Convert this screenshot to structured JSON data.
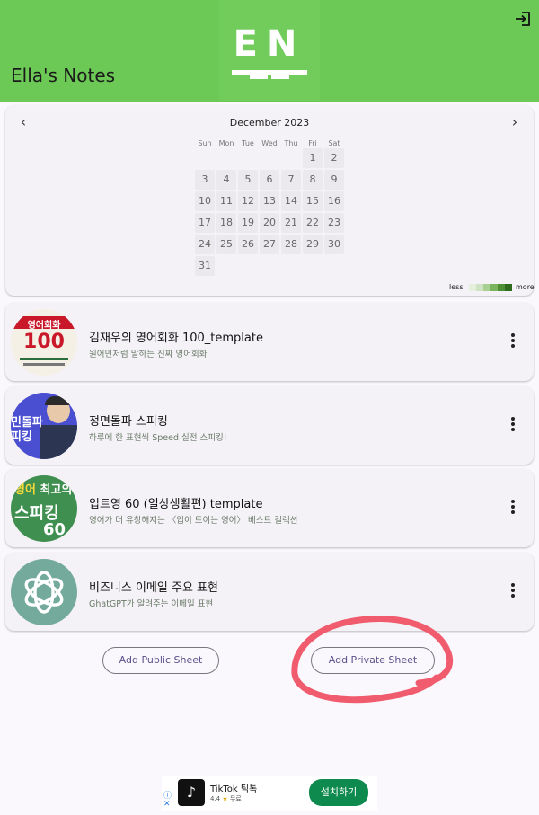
{
  "header": {
    "title": "Ella's Notes",
    "logo_text": "EN",
    "brand_color": "#6cc956",
    "login_icon": "login-icon"
  },
  "calendar": {
    "month_label": "December 2023",
    "prev_icon": "chevron-left-icon",
    "next_icon": "chevron-right-icon",
    "weekdays": [
      "Sun",
      "Mon",
      "Tue",
      "Wed",
      "Thu",
      "Fri",
      "Sat"
    ],
    "first_weekday_index": 5,
    "days": [
      "1",
      "2",
      "3",
      "4",
      "5",
      "6",
      "7",
      "8",
      "9",
      "10",
      "11",
      "12",
      "13",
      "14",
      "15",
      "16",
      "17",
      "18",
      "19",
      "20",
      "21",
      "22",
      "23",
      "24",
      "25",
      "26",
      "27",
      "28",
      "29",
      "30",
      "31"
    ],
    "legend_less": "less",
    "legend_more": "more",
    "legend_colors": [
      "#e4efdd",
      "#cfe3c4",
      "#a8cf94",
      "#7bb35f",
      "#4f8f34",
      "#2e6b1c"
    ]
  },
  "sheets": [
    {
      "title": "김재우의 영어회화 100_template",
      "subtitle": "원어민처럼 말하는 진짜 영어회화",
      "thumb_text": "영어회화 100",
      "more_icon": "more-vert-icon"
    },
    {
      "title": "정면돌파 스피킹",
      "subtitle": "하루에 한 표현씩 Speed 실전 스피킹!",
      "thumb_text": "민돌파 피킹",
      "more_icon": "more-vert-icon"
    },
    {
      "title": "입트영 60 (일상생활편) template",
      "subtitle": "영어가 더 유창해지는 〈입이 트이는 영어〉 베스트 컬렉션",
      "thumb_text": "스피킹 60",
      "more_icon": "more-vert-icon"
    },
    {
      "title": "비즈니스 이메일 주요 표현",
      "subtitle": "GhatGPT가 알려주는 이메일 표현",
      "thumb_text": "",
      "more_icon": "more-vert-icon"
    }
  ],
  "actions": {
    "add_public": "Add Public Sheet",
    "add_private": "Add Private Sheet"
  },
  "ad": {
    "app_name": "TikTok 틱톡",
    "rating": "4.4",
    "price": "무료",
    "install": "설치하기",
    "info_icon": "ⓘ",
    "close_icon": "✕"
  }
}
